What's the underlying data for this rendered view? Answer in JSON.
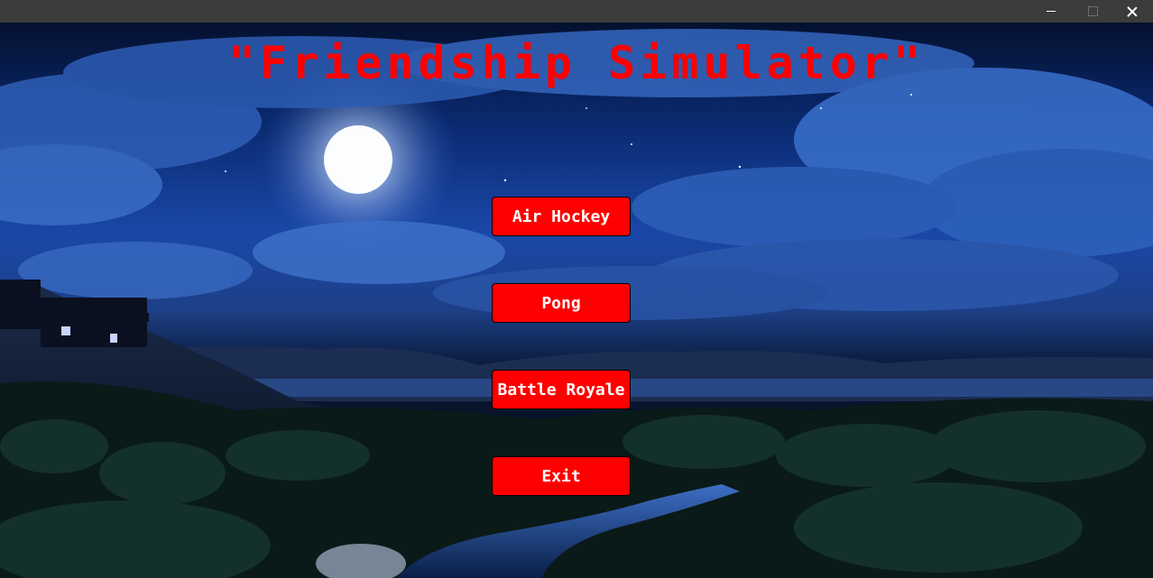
{
  "window": {
    "controls": {
      "minimize_icon": "minimize-icon",
      "maximize_icon": "maximize-icon",
      "close_icon": "close-icon"
    },
    "titlebar_color": "#3c3c3c"
  },
  "game": {
    "title": "\"Friendship Simulator\"",
    "title_color": "#ff0000"
  },
  "menu": {
    "button_color": "#ff0000",
    "items": [
      {
        "label": "Air Hockey"
      },
      {
        "label": "Pong"
      },
      {
        "label": "Battle Royale"
      },
      {
        "label": "Exit"
      }
    ]
  },
  "background": {
    "scene": "night-sky-moon-tropical-landscape"
  }
}
